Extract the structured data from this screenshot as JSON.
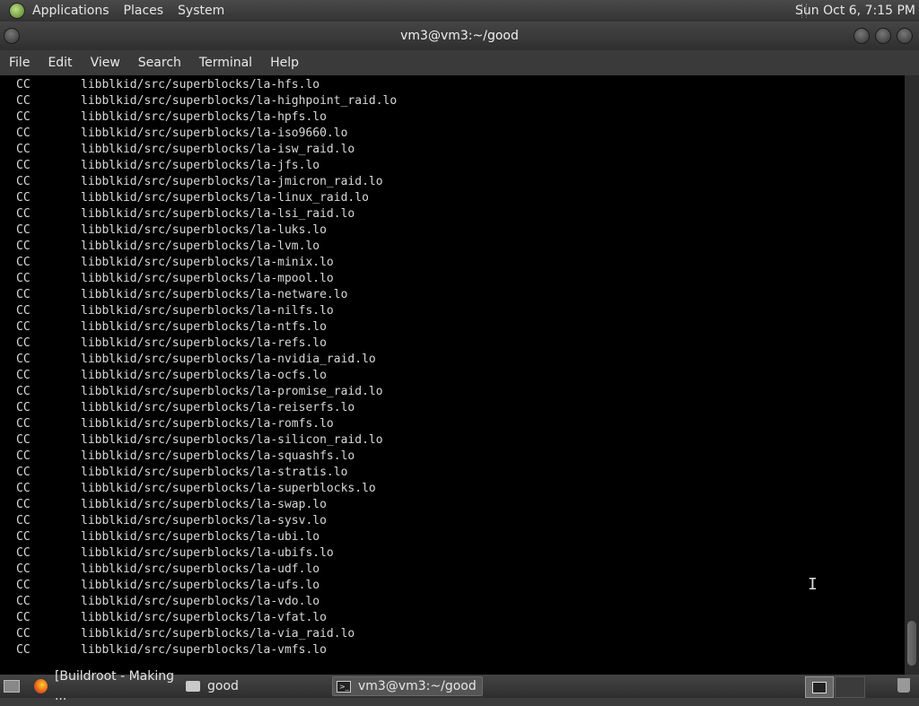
{
  "top_panel": {
    "menus": [
      "Applications",
      "Places",
      "System"
    ],
    "clock": "Sun Oct 6, 7:15 PM"
  },
  "window": {
    "title": "vm3@vm3:~/good"
  },
  "menubar": [
    "File",
    "Edit",
    "View",
    "Search",
    "Terminal",
    "Help"
  ],
  "terminal": {
    "lines": [
      {
        "cc": "CC",
        "path": "libblkid/src/superblocks/la-hfs.lo"
      },
      {
        "cc": "CC",
        "path": "libblkid/src/superblocks/la-highpoint_raid.lo"
      },
      {
        "cc": "CC",
        "path": "libblkid/src/superblocks/la-hpfs.lo"
      },
      {
        "cc": "CC",
        "path": "libblkid/src/superblocks/la-iso9660.lo"
      },
      {
        "cc": "CC",
        "path": "libblkid/src/superblocks/la-isw_raid.lo"
      },
      {
        "cc": "CC",
        "path": "libblkid/src/superblocks/la-jfs.lo"
      },
      {
        "cc": "CC",
        "path": "libblkid/src/superblocks/la-jmicron_raid.lo"
      },
      {
        "cc": "CC",
        "path": "libblkid/src/superblocks/la-linux_raid.lo"
      },
      {
        "cc": "CC",
        "path": "libblkid/src/superblocks/la-lsi_raid.lo"
      },
      {
        "cc": "CC",
        "path": "libblkid/src/superblocks/la-luks.lo"
      },
      {
        "cc": "CC",
        "path": "libblkid/src/superblocks/la-lvm.lo"
      },
      {
        "cc": "CC",
        "path": "libblkid/src/superblocks/la-minix.lo"
      },
      {
        "cc": "CC",
        "path": "libblkid/src/superblocks/la-mpool.lo"
      },
      {
        "cc": "CC",
        "path": "libblkid/src/superblocks/la-netware.lo"
      },
      {
        "cc": "CC",
        "path": "libblkid/src/superblocks/la-nilfs.lo"
      },
      {
        "cc": "CC",
        "path": "libblkid/src/superblocks/la-ntfs.lo"
      },
      {
        "cc": "CC",
        "path": "libblkid/src/superblocks/la-refs.lo"
      },
      {
        "cc": "CC",
        "path": "libblkid/src/superblocks/la-nvidia_raid.lo"
      },
      {
        "cc": "CC",
        "path": "libblkid/src/superblocks/la-ocfs.lo"
      },
      {
        "cc": "CC",
        "path": "libblkid/src/superblocks/la-promise_raid.lo"
      },
      {
        "cc": "CC",
        "path": "libblkid/src/superblocks/la-reiserfs.lo"
      },
      {
        "cc": "CC",
        "path": "libblkid/src/superblocks/la-romfs.lo"
      },
      {
        "cc": "CC",
        "path": "libblkid/src/superblocks/la-silicon_raid.lo"
      },
      {
        "cc": "CC",
        "path": "libblkid/src/superblocks/la-squashfs.lo"
      },
      {
        "cc": "CC",
        "path": "libblkid/src/superblocks/la-stratis.lo"
      },
      {
        "cc": "CC",
        "path": "libblkid/src/superblocks/la-superblocks.lo"
      },
      {
        "cc": "CC",
        "path": "libblkid/src/superblocks/la-swap.lo"
      },
      {
        "cc": "CC",
        "path": "libblkid/src/superblocks/la-sysv.lo"
      },
      {
        "cc": "CC",
        "path": "libblkid/src/superblocks/la-ubi.lo"
      },
      {
        "cc": "CC",
        "path": "libblkid/src/superblocks/la-ubifs.lo"
      },
      {
        "cc": "CC",
        "path": "libblkid/src/superblocks/la-udf.lo"
      },
      {
        "cc": "CC",
        "path": "libblkid/src/superblocks/la-ufs.lo"
      },
      {
        "cc": "CC",
        "path": "libblkid/src/superblocks/la-vdo.lo"
      },
      {
        "cc": "CC",
        "path": "libblkid/src/superblocks/la-vfat.lo"
      },
      {
        "cc": "CC",
        "path": "libblkid/src/superblocks/la-via_raid.lo"
      },
      {
        "cc": "CC",
        "path": "libblkid/src/superblocks/la-vmfs.lo"
      }
    ]
  },
  "taskbar": {
    "tasks": [
      {
        "label": "[Buildroot - Making ...",
        "icon": "firefox-icon"
      },
      {
        "label": "good",
        "icon": "folder-icon"
      },
      {
        "label": "vm3@vm3:~/good",
        "icon": "terminal-icon",
        "active": true
      }
    ]
  }
}
